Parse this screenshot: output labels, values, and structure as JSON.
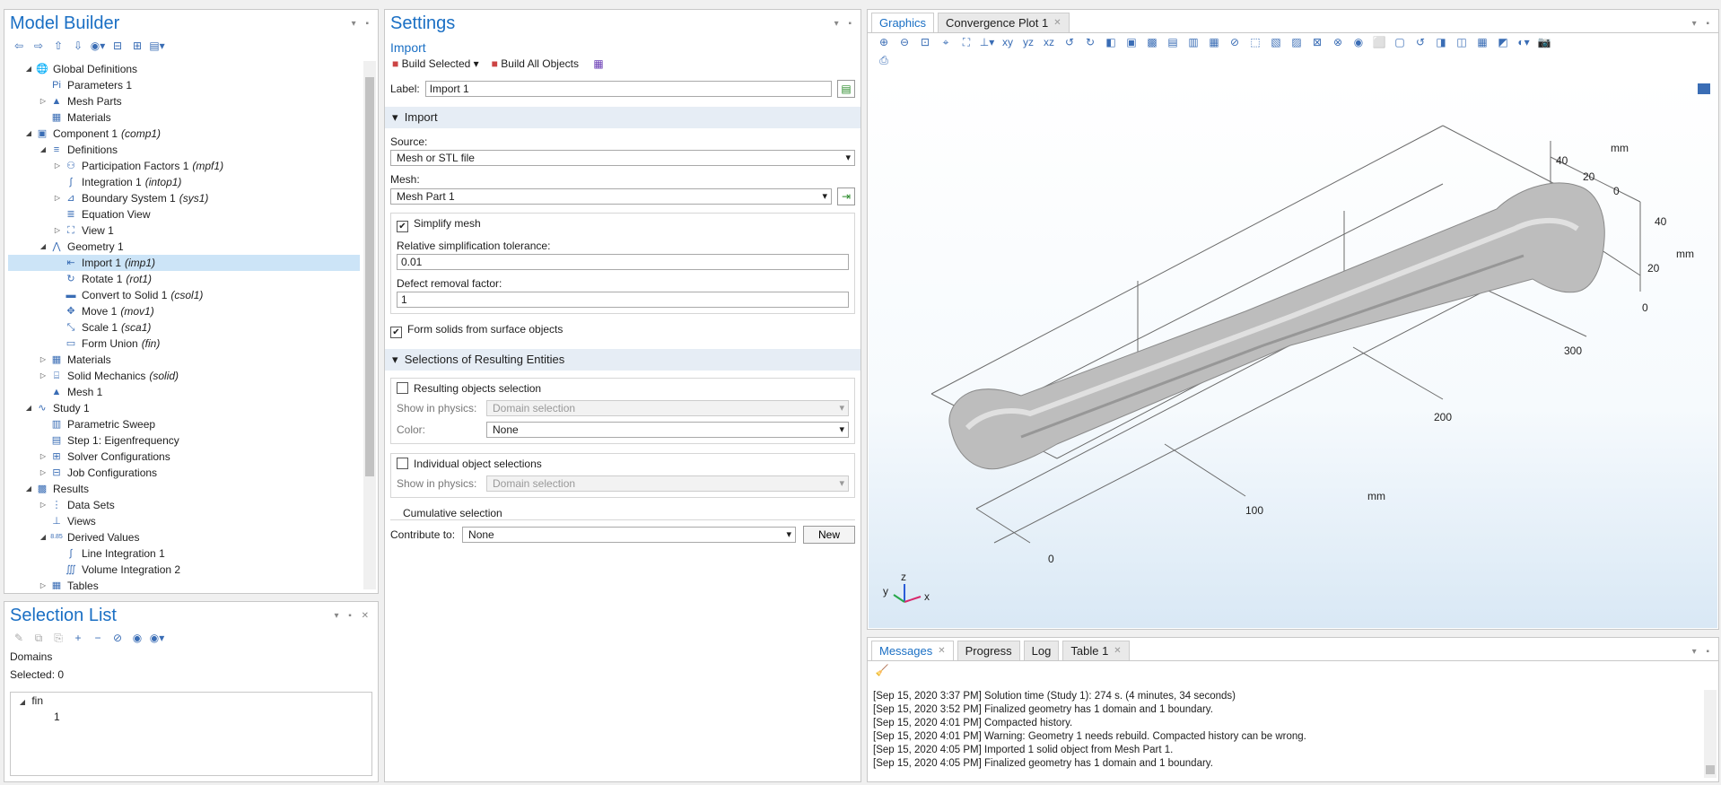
{
  "model_builder": {
    "title": "Model Builder",
    "tree": [
      {
        "label": "Global Definitions",
        "tag": "",
        "depth": 0,
        "toggle": "◢",
        "icon": "globe-icon",
        "glyph": "🌐"
      },
      {
        "label": "Parameters 1",
        "tag": "",
        "depth": 1,
        "toggle": "",
        "icon": "parameters-icon",
        "glyph": "Pi"
      },
      {
        "label": "Mesh Parts",
        "tag": "",
        "depth": 1,
        "toggle": "▷",
        "icon": "mesh-parts-icon",
        "glyph": "▲"
      },
      {
        "label": "Materials",
        "tag": "",
        "depth": 1,
        "toggle": "",
        "icon": "materials-icon",
        "glyph": "▦"
      },
      {
        "label": "Component 1",
        "tag": "(comp1)",
        "depth": 0,
        "toggle": "◢",
        "icon": "component-icon",
        "glyph": "▣"
      },
      {
        "label": "Definitions",
        "tag": "",
        "depth": 1,
        "toggle": "◢",
        "icon": "definitions-icon",
        "glyph": "≡"
      },
      {
        "label": "Participation Factors 1",
        "tag": "(mpf1)",
        "depth": 2,
        "toggle": "▷",
        "icon": "participation-icon",
        "glyph": "⚇"
      },
      {
        "label": "Integration 1",
        "tag": "(intop1)",
        "depth": 2,
        "toggle": "",
        "icon": "integration-icon",
        "glyph": "∫"
      },
      {
        "label": "Boundary System 1",
        "tag": "(sys1)",
        "depth": 2,
        "toggle": "▷",
        "icon": "boundary-system-icon",
        "glyph": "⊿"
      },
      {
        "label": "Equation View",
        "tag": "",
        "depth": 2,
        "toggle": "",
        "icon": "equation-view-icon",
        "glyph": "≣"
      },
      {
        "label": "View 1",
        "tag": "",
        "depth": 2,
        "toggle": "▷",
        "icon": "view-icon",
        "glyph": "⛶"
      },
      {
        "label": "Geometry 1",
        "tag": "",
        "depth": 1,
        "toggle": "◢",
        "icon": "geometry-icon",
        "glyph": "⋀"
      },
      {
        "label": "Import 1",
        "tag": "(imp1)",
        "depth": 2,
        "toggle": "",
        "icon": "import-icon",
        "glyph": "⇤",
        "selected": true
      },
      {
        "label": "Rotate 1",
        "tag": "(rot1)",
        "depth": 2,
        "toggle": "",
        "icon": "rotate-icon",
        "glyph": "↻"
      },
      {
        "label": "Convert to Solid 1",
        "tag": "(csol1)",
        "depth": 2,
        "toggle": "",
        "icon": "convert-solid-icon",
        "glyph": "▬"
      },
      {
        "label": "Move 1",
        "tag": "(mov1)",
        "depth": 2,
        "toggle": "",
        "icon": "move-icon",
        "glyph": "✥"
      },
      {
        "label": "Scale 1",
        "tag": "(sca1)",
        "depth": 2,
        "toggle": "",
        "icon": "scale-icon",
        "glyph": "⤡"
      },
      {
        "label": "Form Union",
        "tag": "(fin)",
        "depth": 2,
        "toggle": "",
        "icon": "form-union-icon",
        "glyph": "▭"
      },
      {
        "label": "Materials",
        "tag": "",
        "depth": 1,
        "toggle": "▷",
        "icon": "materials-icon",
        "glyph": "▦"
      },
      {
        "label": "Solid Mechanics",
        "tag": "(solid)",
        "depth": 1,
        "toggle": "▷",
        "icon": "solid-mechanics-icon",
        "glyph": "⌸"
      },
      {
        "label": "Mesh 1",
        "tag": "",
        "depth": 1,
        "toggle": "",
        "icon": "mesh-icon",
        "glyph": "▲"
      },
      {
        "label": "Study 1",
        "tag": "",
        "depth": 0,
        "toggle": "◢",
        "icon": "study-icon",
        "glyph": "∿"
      },
      {
        "label": "Parametric Sweep",
        "tag": "",
        "depth": 1,
        "toggle": "",
        "icon": "parametric-sweep-icon",
        "glyph": "▥"
      },
      {
        "label": "Step 1: Eigenfrequency",
        "tag": "",
        "depth": 1,
        "toggle": "",
        "icon": "eigenfrequency-icon",
        "glyph": "▤"
      },
      {
        "label": "Solver Configurations",
        "tag": "",
        "depth": 1,
        "toggle": "▷",
        "icon": "solver-icon",
        "glyph": "⊞"
      },
      {
        "label": "Job Configurations",
        "tag": "",
        "depth": 1,
        "toggle": "▷",
        "icon": "job-icon",
        "glyph": "⊟"
      },
      {
        "label": "Results",
        "tag": "",
        "depth": 0,
        "toggle": "◢",
        "icon": "results-icon",
        "glyph": "▩"
      },
      {
        "label": "Data Sets",
        "tag": "",
        "depth": 1,
        "toggle": "▷",
        "icon": "datasets-icon",
        "glyph": "⋮"
      },
      {
        "label": "Views",
        "tag": "",
        "depth": 1,
        "toggle": "",
        "icon": "views-icon",
        "glyph": "⊥"
      },
      {
        "label": "Derived Values",
        "tag": "",
        "depth": 1,
        "toggle": "◢",
        "icon": "derived-values-icon",
        "glyph": "8.85"
      },
      {
        "label": "Line Integration 1",
        "tag": "",
        "depth": 2,
        "toggle": "",
        "icon": "line-integration-icon",
        "glyph": "∫"
      },
      {
        "label": "Volume Integration 2",
        "tag": "",
        "depth": 2,
        "toggle": "",
        "icon": "volume-integration-icon",
        "glyph": "∭"
      },
      {
        "label": "Tables",
        "tag": "",
        "depth": 1,
        "toggle": "▷",
        "icon": "tables-icon",
        "glyph": "▦"
      }
    ]
  },
  "selection_list": {
    "title": "Selection List",
    "entity": "Domains",
    "selected": "Selected: 0",
    "tree_root": "fin",
    "tree_child": "1"
  },
  "settings": {
    "title": "Settings",
    "subtitle": "Import",
    "build_selected": "Build Selected",
    "build_all": "Build All Objects",
    "label_caption": "Label:",
    "label_value": "Import 1",
    "import_section": "Import",
    "source_caption": "Source:",
    "source_value": "Mesh or STL file",
    "mesh_caption": "Mesh:",
    "mesh_value": "Mesh Part 1",
    "simplify_mesh": "Simplify mesh",
    "tolerance_caption": "Relative simplification tolerance:",
    "tolerance_value": "0.01",
    "defect_caption": "Defect removal factor:",
    "defect_value": "1",
    "form_solids": "Form solids from surface objects",
    "selections_section": "Selections of Resulting Entities",
    "resulting_objects": "Resulting objects selection",
    "show_in_physics": "Show in physics:",
    "domain_selection": "Domain selection",
    "color_caption": "Color:",
    "color_value": "None",
    "individual_objects": "Individual object selections",
    "cumulative": "Cumulative selection",
    "contribute_caption": "Contribute to:",
    "contribute_value": "None",
    "new_button": "New"
  },
  "graphics": {
    "tabs": [
      "Graphics",
      "Convergence Plot 1"
    ],
    "axis_labels": {
      "x_unit": "mm",
      "x100": "100",
      "x200": "200",
      "x300": "300",
      "x0": "0",
      "y_unit": "mm",
      "y40": "40",
      "y20": "20",
      "y0": "0",
      "z_unit": "mm",
      "z40": "40",
      "z20": "20",
      "z0": "0"
    },
    "triad": {
      "x": "x",
      "y": "y",
      "z": "z"
    }
  },
  "messages": {
    "tabs": [
      "Messages",
      "Progress",
      "Log",
      "Table 1"
    ],
    "lines": [
      "[Sep 15, 2020 3:37 PM] Solution time (Study 1): 274 s. (4 minutes, 34 seconds)",
      "[Sep 15, 2020 3:52 PM] Finalized geometry has 1 domain and 1 boundary.",
      "[Sep 15, 2020 4:01 PM] Compacted history.",
      "[Sep 15, 2020 4:01 PM] Warning: Geometry 1 needs rebuild. Compacted history can be wrong.",
      "[Sep 15, 2020 4:05 PM] Imported 1 solid object from Mesh Part 1.",
      "[Sep 15, 2020 4:05 PM] Finalized geometry has 1 domain and 1 boundary."
    ]
  },
  "colors": {
    "accent": "#1a6fc4",
    "selected_row": "#cce4f7",
    "section": "#e6edf5"
  }
}
